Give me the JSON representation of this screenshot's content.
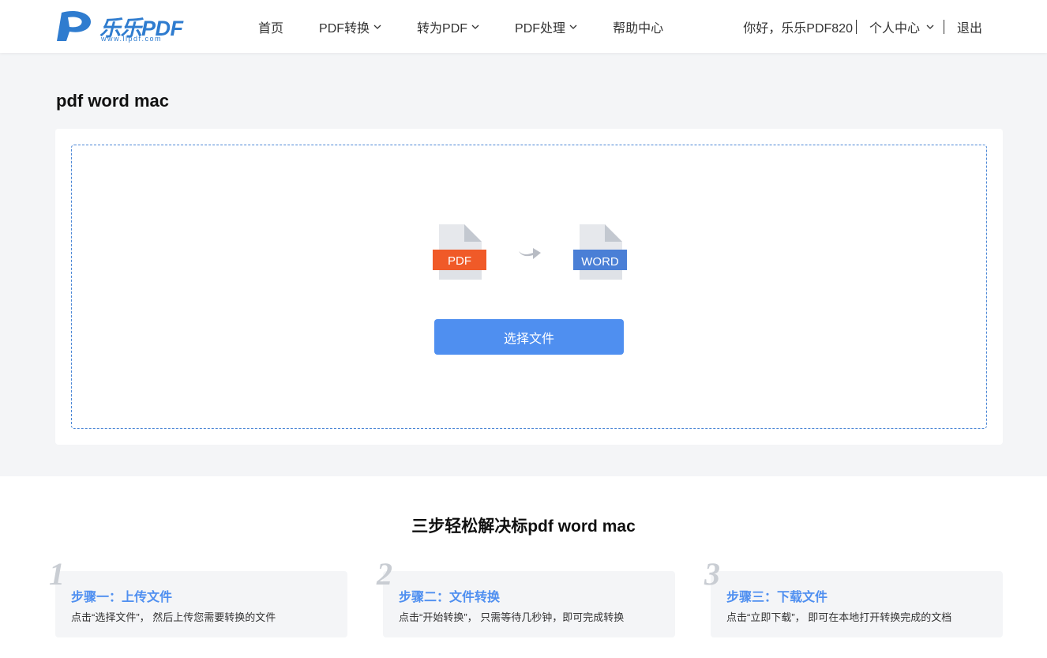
{
  "brand": {
    "logo_mark_text": "PDF",
    "logo_text": "乐乐PDF",
    "logo_url": "www.llpdf.com",
    "primary_color": "#4f8ff0",
    "logo_color": "#2f7ccf"
  },
  "nav": {
    "items": [
      {
        "label": "首页",
        "has_dropdown": false
      },
      {
        "label": "PDF转换",
        "has_dropdown": true
      },
      {
        "label": "转为PDF",
        "has_dropdown": true
      },
      {
        "label": "PDF处理",
        "has_dropdown": true
      },
      {
        "label": "帮助中心",
        "has_dropdown": false
      }
    ]
  },
  "user": {
    "greeting": "你好，乐乐PDF820",
    "center_label": "个人中心",
    "logout_label": "退出"
  },
  "page": {
    "title": "pdf word mac"
  },
  "converter": {
    "from_label": "PDF",
    "to_label": "WORD",
    "from_color": "#f05a28",
    "to_color": "#4a7fd6",
    "select_button": "选择文件"
  },
  "steps": {
    "title": "三步轻松解决标pdf word mac",
    "items": [
      {
        "num": "1",
        "head": "步骤一：上传文件",
        "desc": "点击“选择文件”， 然后上传您需要转换的文件"
      },
      {
        "num": "2",
        "head": "步骤二：文件转换",
        "desc": "点击“开始转换”， 只需等待几秒钟，即可完成转换"
      },
      {
        "num": "3",
        "head": "步骤三：下载文件",
        "desc": "点击“立即下载”， 即可在本地打开转换完成的文档"
      }
    ]
  }
}
